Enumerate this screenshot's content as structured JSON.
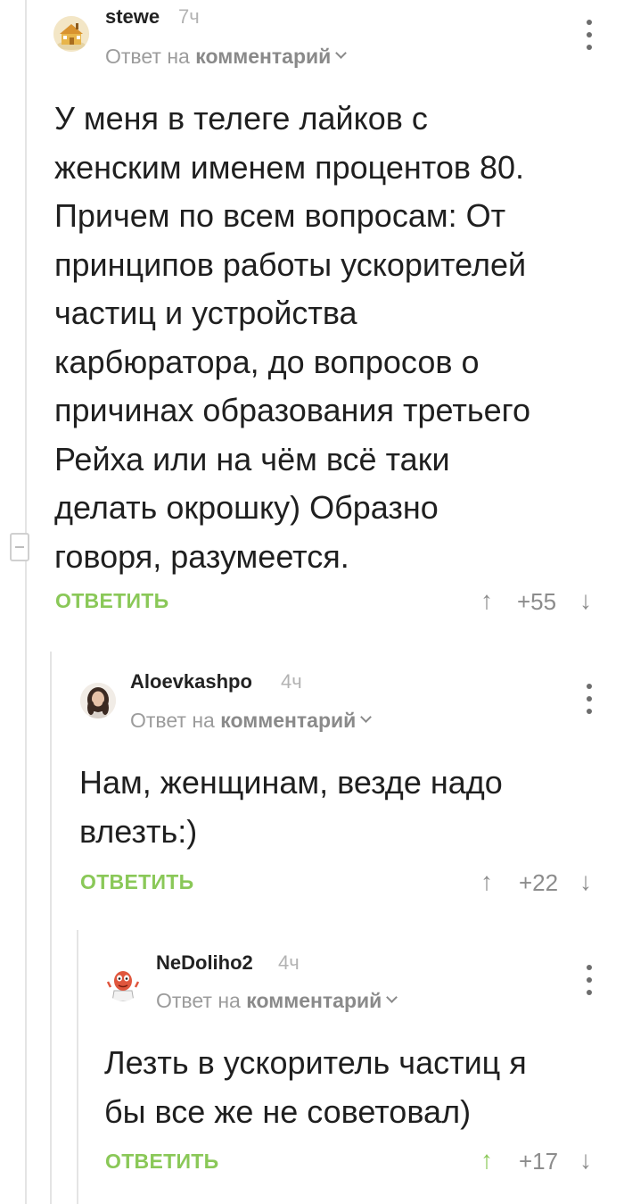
{
  "comments": [
    {
      "author": "stewe",
      "time": "7ч",
      "reply_prefix": "Ответ на",
      "reply_link": "комментарий",
      "text_lines": [
        "У меня в телеге лайков с",
        "женским именем процентов 80.",
        "Причем по всем вопросам: От",
        "принципов работы ускорителей",
        "частиц и устройства",
        "карбюратора, до вопросов о",
        "причинах образования третьего",
        "Рейха или на чём всё таки",
        "делать окрошку) Образно",
        "говоря, разумеется."
      ],
      "reply_label": "ОТВЕТИТЬ",
      "rating": "+55"
    },
    {
      "author": "Aloevkashpo",
      "time": "4ч",
      "reply_prefix": "Ответ на",
      "reply_link": "комментарий",
      "text_lines": [
        "Нам, женщинам, везде надо",
        "влезть:)"
      ],
      "reply_label": "ОТВЕТИТЬ",
      "rating": "+22"
    },
    {
      "author": "NeDoliho2",
      "time": "4ч",
      "reply_prefix": "Ответ на",
      "reply_link": "комментарий",
      "text_lines": [
        "Лезть в ускоритель частиц я",
        "бы все же не советовал)"
      ],
      "reply_label": "ОТВЕТИТЬ",
      "rating": "+17"
    }
  ],
  "icons": {
    "upvote": "↑",
    "downvote": "↓"
  },
  "colors": {
    "accent_green": "#8ac858",
    "thread_line": "#e4e4e4",
    "meta_gray": "#9c9c9c"
  }
}
